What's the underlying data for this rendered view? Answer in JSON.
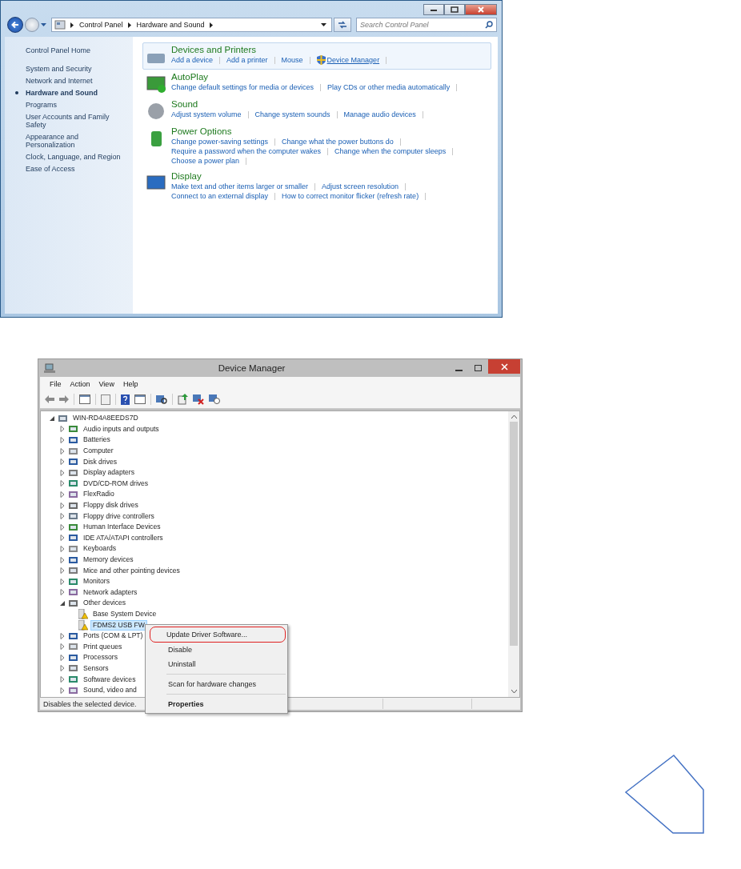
{
  "control_panel": {
    "address": [
      "Control Panel",
      "Hardware and Sound"
    ],
    "search": {
      "placeholder": "Search Control Panel"
    },
    "sidebar": {
      "home": "Control Panel Home",
      "items": [
        {
          "label": "System and Security",
          "selected": false
        },
        {
          "label": "Network and Internet",
          "selected": false
        },
        {
          "label": "Hardware and Sound",
          "selected": true
        },
        {
          "label": "Programs",
          "selected": false
        },
        {
          "label": "User Accounts and Family Safety",
          "selected": false
        },
        {
          "label": "Appearance and Personalization",
          "selected": false
        },
        {
          "label": "Clock, Language, and Region",
          "selected": false
        },
        {
          "label": "Ease of Access",
          "selected": false
        }
      ]
    },
    "categories": [
      {
        "title": "Devices and Printers",
        "kind": "printer",
        "highlighted": true,
        "lines": [
          [
            {
              "text": "Add a device",
              "kind": "plain"
            },
            {
              "text": "Add a printer",
              "kind": "plain"
            },
            {
              "text": "Mouse",
              "kind": "plain"
            },
            {
              "text": "Device Manager",
              "kind": "shield"
            }
          ]
        ]
      },
      {
        "title": "AutoPlay",
        "kind": "autoplay",
        "highlighted": false,
        "lines": [
          [
            {
              "text": "Change default settings for media or devices",
              "kind": "plain"
            },
            {
              "text": "Play CDs or other media automatically",
              "kind": "plain"
            }
          ]
        ]
      },
      {
        "title": "Sound",
        "kind": "speaker",
        "highlighted": false,
        "lines": [
          [
            {
              "text": "Adjust system volume",
              "kind": "plain"
            },
            {
              "text": "Change system sounds",
              "kind": "plain"
            },
            {
              "text": "Manage audio devices",
              "kind": "plain"
            }
          ]
        ]
      },
      {
        "title": "Power Options",
        "kind": "battery",
        "highlighted": false,
        "lines": [
          [
            {
              "text": "Change power-saving settings",
              "kind": "plain"
            },
            {
              "text": "Change what the power buttons do",
              "kind": "plain"
            }
          ],
          [
            {
              "text": "Require a password when the computer wakes",
              "kind": "plain"
            },
            {
              "text": "Change when the computer sleeps",
              "kind": "plain"
            }
          ],
          [
            {
              "text": "Choose a power plan",
              "kind": "plain"
            }
          ]
        ]
      },
      {
        "title": "Display",
        "kind": "monitor",
        "highlighted": false,
        "lines": [
          [
            {
              "text": "Make text and other items larger or smaller",
              "kind": "plain"
            },
            {
              "text": "Adjust screen resolution",
              "kind": "plain"
            }
          ],
          [
            {
              "text": "Connect to an external display",
              "kind": "plain"
            },
            {
              "text": "How to correct monitor flicker (refresh rate)",
              "kind": "plain"
            }
          ]
        ]
      }
    ]
  },
  "device_manager": {
    "title": "Device Manager",
    "menu": [
      "File",
      "Action",
      "View",
      "Help"
    ],
    "tree": {
      "label": "WIN-RD4A8EEDS7D",
      "expanded": true,
      "selected": false,
      "children": [
        {
          "label": "Audio inputs and outputs",
          "expanded": false,
          "selected": false
        },
        {
          "label": "Batteries",
          "expanded": false,
          "selected": false
        },
        {
          "label": "Computer",
          "expanded": false,
          "selected": false
        },
        {
          "label": "Disk drives",
          "expanded": false,
          "selected": false
        },
        {
          "label": "Display adapters",
          "expanded": false,
          "selected": false
        },
        {
          "label": "DVD/CD-ROM drives",
          "expanded": false,
          "selected": false
        },
        {
          "label": "FlexRadio",
          "expanded": false,
          "selected": false
        },
        {
          "label": "Floppy disk drives",
          "expanded": false,
          "selected": false
        },
        {
          "label": "Floppy drive controllers",
          "expanded": false,
          "selected": false
        },
        {
          "label": "Human Interface Devices",
          "expanded": false,
          "selected": false
        },
        {
          "label": "IDE ATA/ATAPI controllers",
          "expanded": false,
          "selected": false
        },
        {
          "label": "Keyboards",
          "expanded": false,
          "selected": false
        },
        {
          "label": "Memory devices",
          "expanded": false,
          "selected": false
        },
        {
          "label": "Mice and other pointing devices",
          "expanded": false,
          "selected": false
        },
        {
          "label": "Monitors",
          "expanded": false,
          "selected": false
        },
        {
          "label": "Network adapters",
          "expanded": false,
          "selected": false
        },
        {
          "label": "Other devices",
          "expanded": true,
          "selected": false,
          "children": [
            {
              "label": "Base System Device",
              "kind": "warning",
              "selected": false
            },
            {
              "label": "FDMS2 USB FW",
              "kind": "warning",
              "selected": true
            }
          ]
        },
        {
          "label": "Ports (COM & LPT)",
          "expanded": false,
          "selected": false
        },
        {
          "label": "Print queues",
          "expanded": false,
          "selected": false
        },
        {
          "label": "Processors",
          "expanded": false,
          "selected": false
        },
        {
          "label": "Sensors",
          "expanded": false,
          "selected": false
        },
        {
          "label": "Software devices",
          "expanded": false,
          "selected": false
        },
        {
          "label": "Sound, video and",
          "expanded": false,
          "selected": false
        }
      ]
    },
    "context_menu": [
      {
        "label": "Update Driver Software...",
        "circled": true,
        "bold": false,
        "separator_before": false
      },
      {
        "label": "Disable",
        "circled": false,
        "bold": false,
        "separator_before": false
      },
      {
        "label": "Uninstall",
        "circled": false,
        "bold": false,
        "separator_before": false
      },
      {
        "label": "Scan for hardware changes",
        "circled": false,
        "bold": false,
        "separator_before": true
      },
      {
        "label": "Properties",
        "circled": false,
        "bold": true,
        "separator_before": true
      }
    ],
    "status_bar": "Disables the selected device."
  }
}
